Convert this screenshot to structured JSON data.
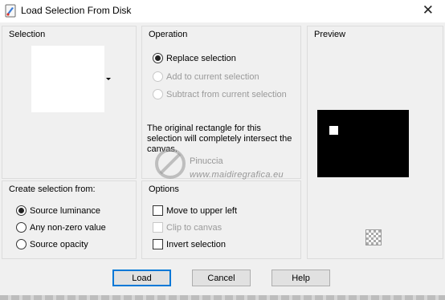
{
  "window": {
    "title": "Load Selection From Disk",
    "icon": "paint-app-icon",
    "close_glyph": "✕"
  },
  "selection_group": {
    "label": "Selection",
    "preview_bg": "#ffffff"
  },
  "operation_group": {
    "label": "Operation",
    "options": [
      {
        "label": "Replace selection",
        "checked": true,
        "enabled": true
      },
      {
        "label": "Add to current selection",
        "checked": false,
        "enabled": false
      },
      {
        "label": "Subtract from current selection",
        "checked": false,
        "enabled": false
      }
    ],
    "info_text": "The original rectangle for this selection will completely intersect the canvas."
  },
  "preview_group": {
    "label": "Preview",
    "preview_bg": "#000000",
    "icon": "checkerboard-icon"
  },
  "create_from_group": {
    "label": "Create selection from:",
    "options": [
      {
        "label": "Source luminance",
        "checked": true
      },
      {
        "label": "Any non-zero value",
        "checked": false
      },
      {
        "label": "Source opacity",
        "checked": false
      }
    ]
  },
  "options_group": {
    "label": "Options",
    "checkboxes": [
      {
        "label": "Move to upper left",
        "checked": false,
        "enabled": true
      },
      {
        "label": "Clip to canvas",
        "checked": false,
        "enabled": false
      },
      {
        "label": "Invert selection",
        "checked": false,
        "enabled": true
      }
    ]
  },
  "buttons": {
    "load": "Load",
    "cancel": "Cancel",
    "help": "Help"
  },
  "watermark": {
    "line1": "Pinuccia",
    "line2": "www.maidiregrafica.eu"
  },
  "colors": {
    "accent": "#0078d7",
    "dialog_bg": "#f0f0f0"
  }
}
